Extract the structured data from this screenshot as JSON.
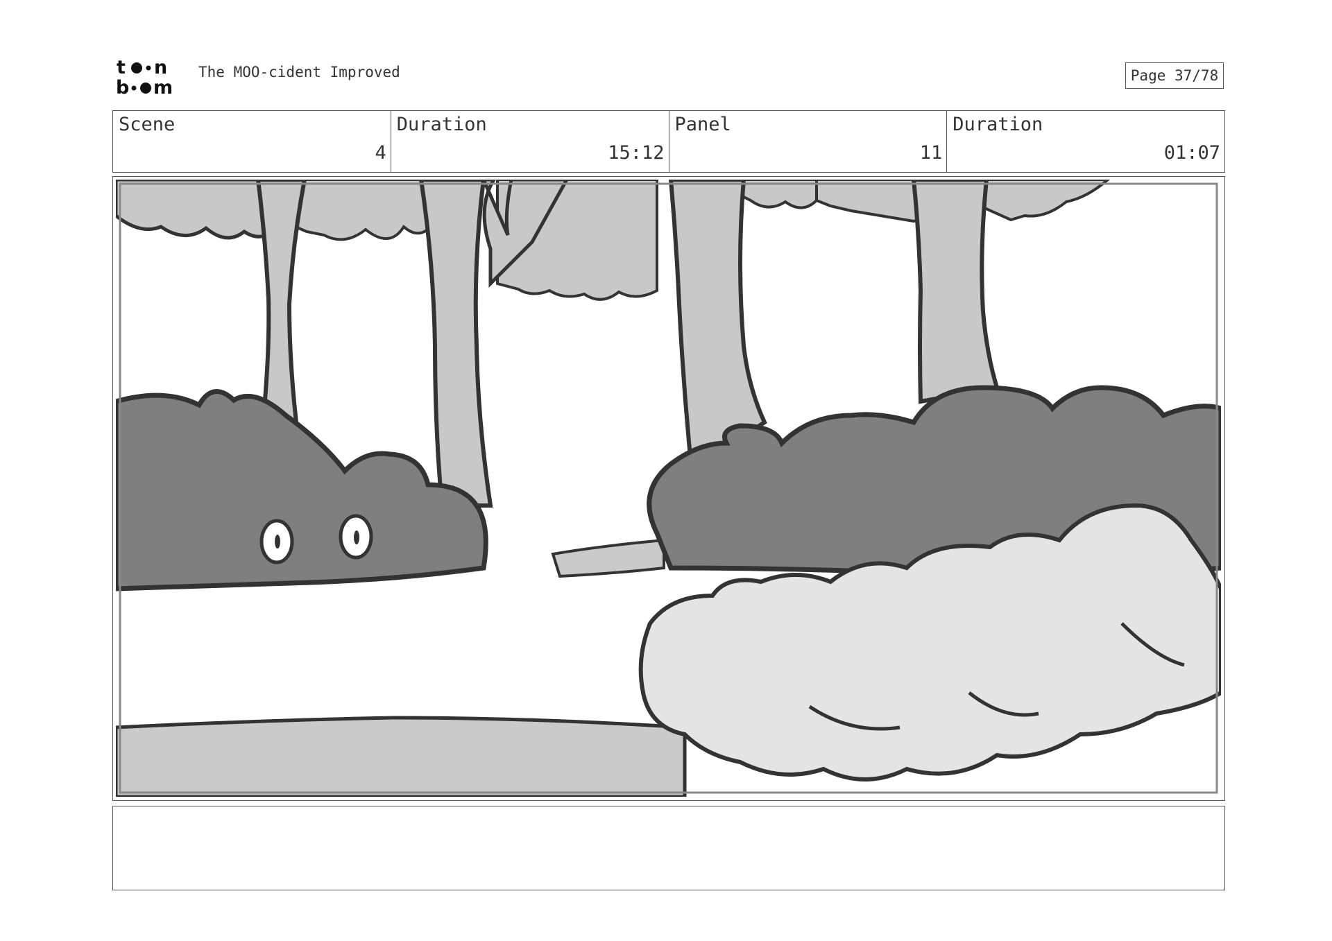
{
  "header": {
    "logo_text": "toon boom",
    "title": "The MOO-cident Improved",
    "page": "Page 37/78"
  },
  "info": {
    "scene_label": "Scene",
    "scene_value": "4",
    "scene_duration_label": "Duration",
    "scene_duration_value": "15:12",
    "panel_label": "Panel",
    "panel_value": "11",
    "panel_duration_label": "Duration",
    "panel_duration_value": "01:07"
  },
  "panel": {
    "description": "Sketch of a forest: tree trunks and foliage, dark bushes with a pair of eyes peeking out, a dust cloud in the foreground",
    "colors": {
      "outline": "#333333",
      "foliage": "#c8c8c8",
      "bush": "#7f7f7f",
      "ground": "#cacaca",
      "dust": "#e4e4e4"
    }
  },
  "notes": {
    "text": ""
  }
}
